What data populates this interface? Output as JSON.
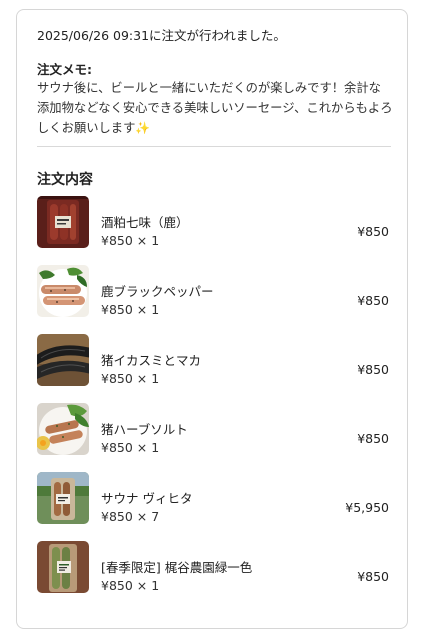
{
  "order": {
    "ordered_at": "2025/06/26 09:31に注文が行われました。",
    "memo_title": "注文メモ:",
    "memo_body": "サウナ後に、ビールと一緒にいただくのが楽しみです！余計な添加物などなく安心できる美味しいソーセージ、これからもよろしくお願いします",
    "memo_emoji": "✨",
    "section_title": "注文内容"
  },
  "items": [
    {
      "name": "酒粕七味（鹿）",
      "qty": "¥850 × 1",
      "price": "¥850",
      "thumb": "bagged-sausage-image"
    },
    {
      "name": "鹿ブラックペッパー",
      "qty": "¥850 × 1",
      "price": "¥850",
      "thumb": "grilled-sausage-image"
    },
    {
      "name": "猪イカスミとマカ",
      "qty": "¥850 × 1",
      "price": "¥850",
      "thumb": "black-sausage-image"
    },
    {
      "name": "猪ハーブソルト",
      "qty": "¥850 × 1",
      "price": "¥850",
      "thumb": "herb-sausage-plate-image"
    },
    {
      "name": "サウナ ヴィヒタ",
      "qty": "¥850 × 7",
      "price": "¥5,950",
      "thumb": "sauna-sausage-package-image"
    },
    {
      "name": "[春季限定] 梶谷農園緑一色",
      "qty": "¥850 × 1",
      "price": "¥850",
      "thumb": "green-sausage-package-image"
    }
  ]
}
